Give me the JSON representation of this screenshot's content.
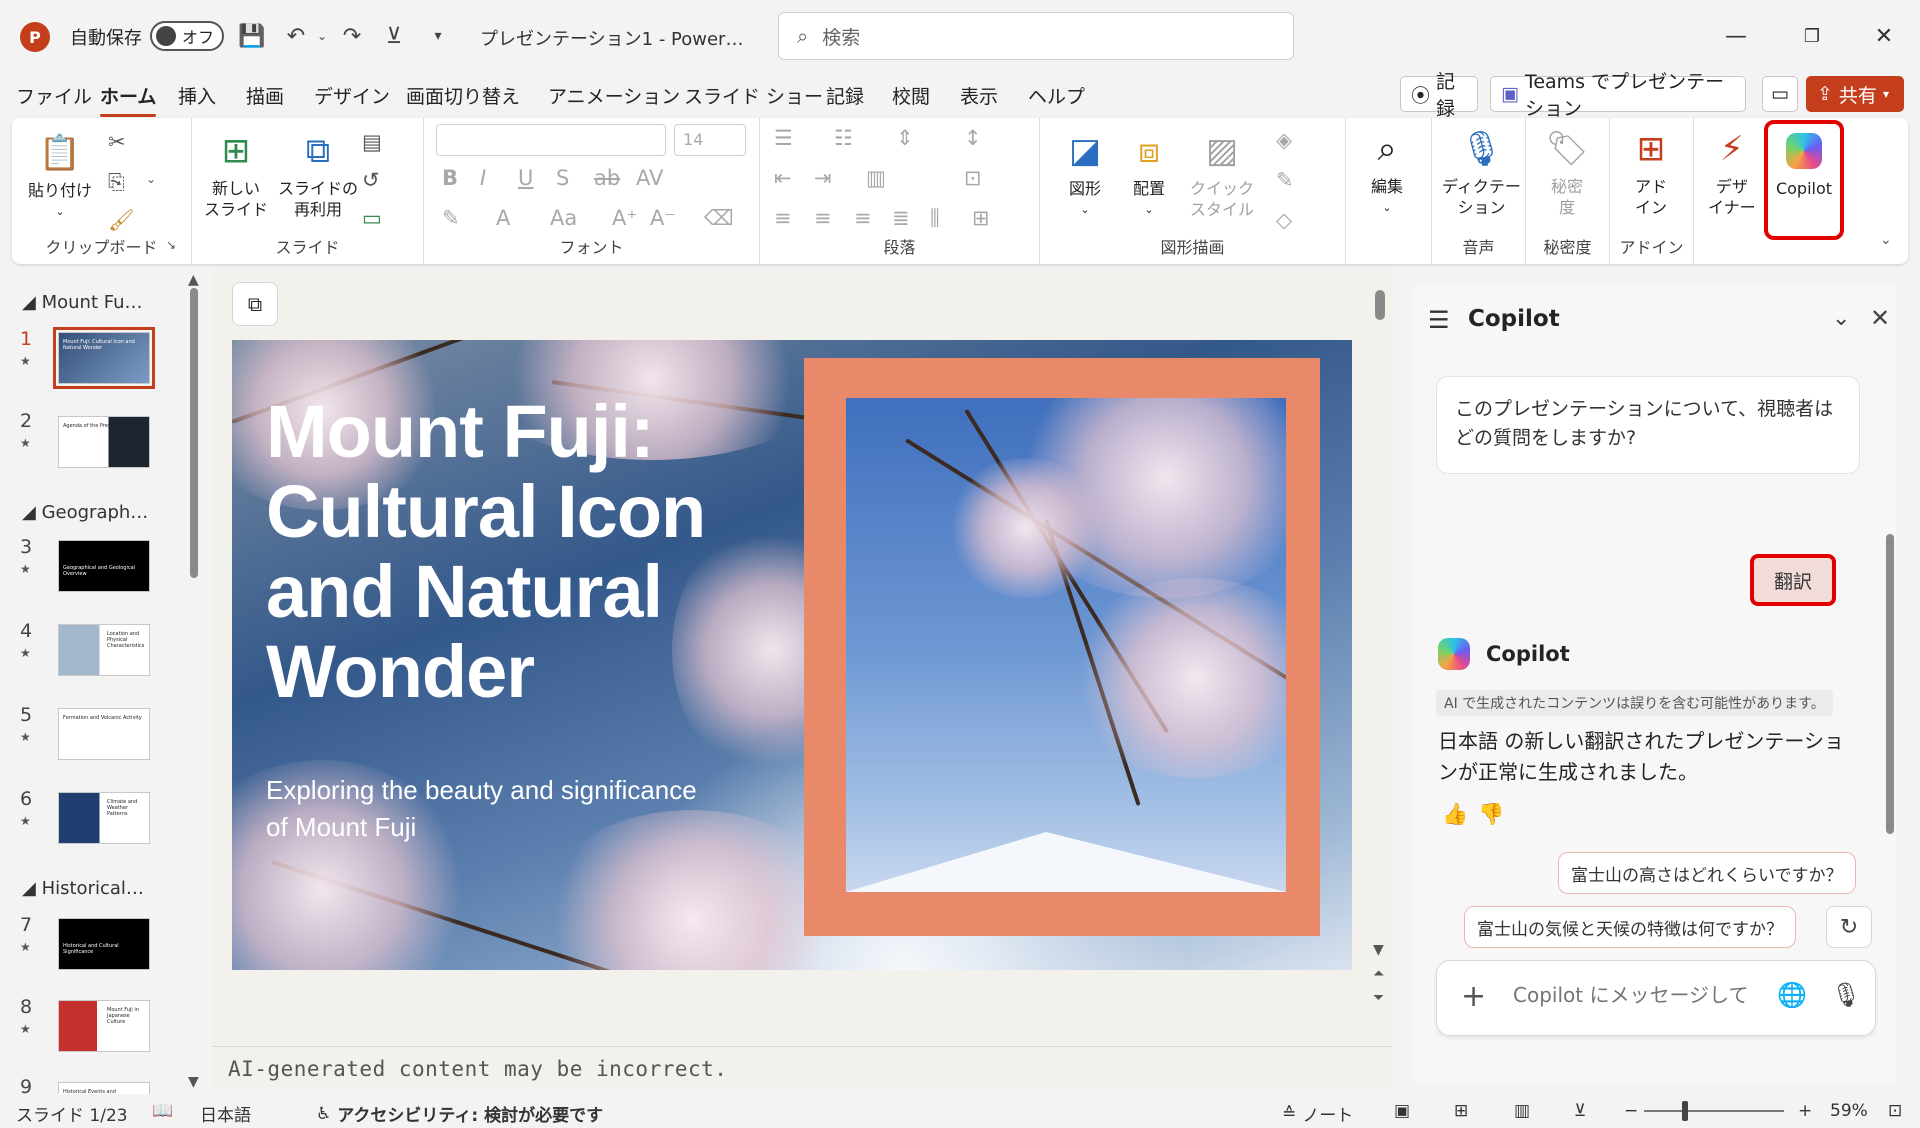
{
  "titlebar": {
    "app_logo": "P",
    "autosave_label": "自動保存",
    "autosave_state": "オフ",
    "doc_title": "プレゼンテーション1  -  Power…",
    "search_placeholder": "検索",
    "icons": [
      "save-icon",
      "undo-icon",
      "redo-icon",
      "present-icon",
      "customize-qat-icon"
    ]
  },
  "menu": {
    "tabs": [
      "ファイル",
      "ホーム",
      "挿入",
      "描画",
      "デザイン",
      "画面切り替え",
      "アニメーション",
      "スライド ショー",
      "記録",
      "校閲",
      "表示",
      "ヘルプ"
    ],
    "active_tab": "ホーム",
    "record_btn": "記録",
    "teams_btn": "Teams でプレゼンテーション",
    "share_btn": "共有"
  },
  "ribbon": {
    "clipboard": {
      "paste": "貼り付け",
      "group": "クリップボード"
    },
    "slides": {
      "new_slide_1": "新しい",
      "new_slide_2": "スライド",
      "reuse_1": "スライドの",
      "reuse_2": "再利用",
      "group": "スライド"
    },
    "font": {
      "size_placeholder": "14",
      "group": "フォント"
    },
    "paragraph": {
      "group": "段落"
    },
    "drawing": {
      "shapes": "図形",
      "arrange": "配置",
      "quick_1": "クイック",
      "quick_2": "スタイル",
      "group": "図形描画"
    },
    "editing": {
      "label": "編集"
    },
    "voice": {
      "dictate_1": "ディクテー",
      "dictate_2": "ション",
      "group": "音声"
    },
    "sensitivity": {
      "label_1": "秘密",
      "label_2": "度",
      "group": "秘密度"
    },
    "addins": {
      "label_1": "アド",
      "label_2": "イン",
      "group": "アドイン"
    },
    "designer": {
      "label_1": "デザ",
      "label_2": "イナー"
    },
    "copilot": {
      "label": "Copilot"
    }
  },
  "thumbnails": {
    "sections": [
      "Mount Fu…",
      "Geograph…",
      "Historical…"
    ],
    "slides": [
      {
        "num": "1",
        "caption": "Mount Fuji: Cultural Icon and Natural Wonder"
      },
      {
        "num": "2",
        "caption": "Agenda of the Presentation"
      },
      {
        "num": "3",
        "caption": "Geographical and Geological Overview"
      },
      {
        "num": "4",
        "caption": "Location and Physical Characteristics"
      },
      {
        "num": "5",
        "caption": "Formation and Volcanic Activity"
      },
      {
        "num": "6",
        "caption": "Climate and Weather Patterns"
      },
      {
        "num": "7",
        "caption": "Historical and Cultural Significance"
      },
      {
        "num": "8",
        "caption": "Mount Fuji in Japanese Culture"
      },
      {
        "num": "9",
        "caption": "Historical Events and"
      }
    ]
  },
  "slide": {
    "title": "Mount Fuji: Cultural Icon and Natural Wonder",
    "subtitle": "Exploring the beauty and significance of Mount Fuji",
    "frame_color": "#e8896a"
  },
  "notes": {
    "text": "AI-generated content may be incorrect."
  },
  "copilot": {
    "title": "Copilot",
    "prompt_card": "このプレゼンテーションについて、視聴者はどの質問をしますか?",
    "user_message": "翻訳",
    "assistant_name": "Copilot",
    "disclaimer": "AI で生成されたコンテンツは誤りを含む可能性があります。",
    "response": "日本語 の新しい翻訳されたプレゼンテーションが正常に生成されました。",
    "suggestions": [
      "富士山の高さはどれくらいですか？",
      "富士山の気候と天候の特徴は何ですか？"
    ],
    "input_placeholder": "Copilot にメッセージして"
  },
  "statusbar": {
    "slide_count": "スライド 1/23",
    "language": "日本語",
    "accessibility": "アクセシビリティ: 検討が必要です",
    "notes": "ノート",
    "zoom": "59%"
  },
  "colors": {
    "accent": "#c43e1c",
    "highlight": "#e00000"
  }
}
